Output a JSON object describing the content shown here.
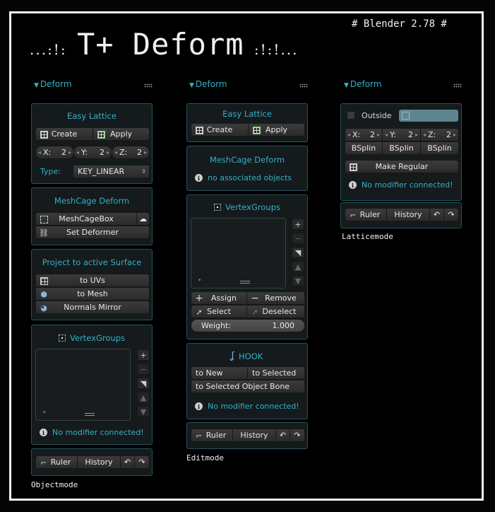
{
  "version": "# Blender 2.78 #",
  "title": {
    "left_dots": "...:!:",
    "text": "T+ Deform",
    "right_dots": ":!:!..."
  },
  "header": {
    "label": "Deform"
  },
  "objectmode": {
    "label": "Objectmode",
    "easy_lattice": {
      "title": "Easy Lattice",
      "create": "Create",
      "apply": "Apply",
      "x": "X:",
      "x_val": "2",
      "y": "Y:",
      "y_val": "2",
      "z": "Z:",
      "z_val": "2",
      "type_label": "Type:",
      "type_value": "KEY_LINEAR"
    },
    "meshcage": {
      "title": "MeshCage Deform",
      "box": "MeshCageBox",
      "set_deformer": "Set Deformer"
    },
    "project": {
      "title": "Project to active Surface",
      "to_uvs": "to UVs",
      "to_mesh": "to Mesh",
      "normals_mirror": "Normals Mirror"
    },
    "vertex_groups": {
      "title": "VertexGroups",
      "info": "No modifier connected!"
    },
    "footer": {
      "ruler": "Ruler",
      "history": "History"
    }
  },
  "editmode": {
    "label": "Editmode",
    "easy_lattice": {
      "title": "Easy Lattice",
      "create": "Create",
      "apply": "Apply"
    },
    "meshcage": {
      "title": "MeshCage Deform",
      "info": "no associated objects"
    },
    "vertex_groups": {
      "title": "VertexGroups",
      "assign": "Assign",
      "remove": "Remove",
      "select": "Select",
      "deselect": "Deselect",
      "weight_label": "Weight:",
      "weight_value": "1.000"
    },
    "hook": {
      "title": "HOOK",
      "to_new": "to New",
      "to_selected": "to Selected",
      "to_selected_bone": "to Selected Object Bone",
      "info": "No modifier connected!"
    },
    "footer": {
      "ruler": "Ruler",
      "history": "History"
    }
  },
  "latticemode": {
    "label": "Latticemode",
    "outside": "Outside",
    "x": "X:",
    "x_val": "2",
    "y": "Y:",
    "y_val": "2",
    "z": "Z:",
    "z_val": "2",
    "interp": [
      "BSplin",
      "BSplin",
      "BSplin"
    ],
    "make_regular": "Make Regular",
    "info": "No modifier connected!",
    "footer": {
      "ruler": "Ruler",
      "history": "History"
    }
  },
  "colors": {
    "accent": "#35b0c8",
    "panel_border": "#25535a",
    "button": "#333333"
  }
}
